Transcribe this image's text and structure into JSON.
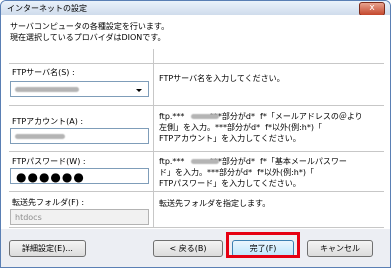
{
  "window": {
    "title": "インターネットの設定",
    "close_glyph": "x"
  },
  "description": "サーバコンピュータの各種設定を行います。\n現在選択しているプロバイダはDIONです。",
  "ftp_server": {
    "label": "FTPサーバ名(S) :",
    "help": "FTPサーバ名を入力してください。"
  },
  "ftp_account": {
    "label": "FTPアカウント(A) :",
    "help": "ftp.***          ***部分がd*  f*「メールアドレスの＠より\n左側」を入力。***部分がd*  f*以外(例:h*)「\nFTPアカウント」を入力してください。"
  },
  "ftp_password": {
    "label": "FTPパスワード(W) :",
    "value": "●●●●●●",
    "help": "ftp.***          ***部分がd*  f*「基本メールパスワー\nド」を入力。***部分がd*  f*以外(例:h*)「\nFTPパスワード」を入力してください。"
  },
  "transfer_folder": {
    "label": "転送先フォルダ(F) :",
    "value": "htdocs",
    "help": "転送先フォルダを指定します。"
  },
  "buttons": {
    "details": "詳細設定(E)...",
    "back": "< 戻る(B)",
    "finish": "完了(F)",
    "cancel": "キャンセル"
  },
  "colors": {
    "highlight": "#e60012",
    "input_border": "#7f9db9"
  }
}
